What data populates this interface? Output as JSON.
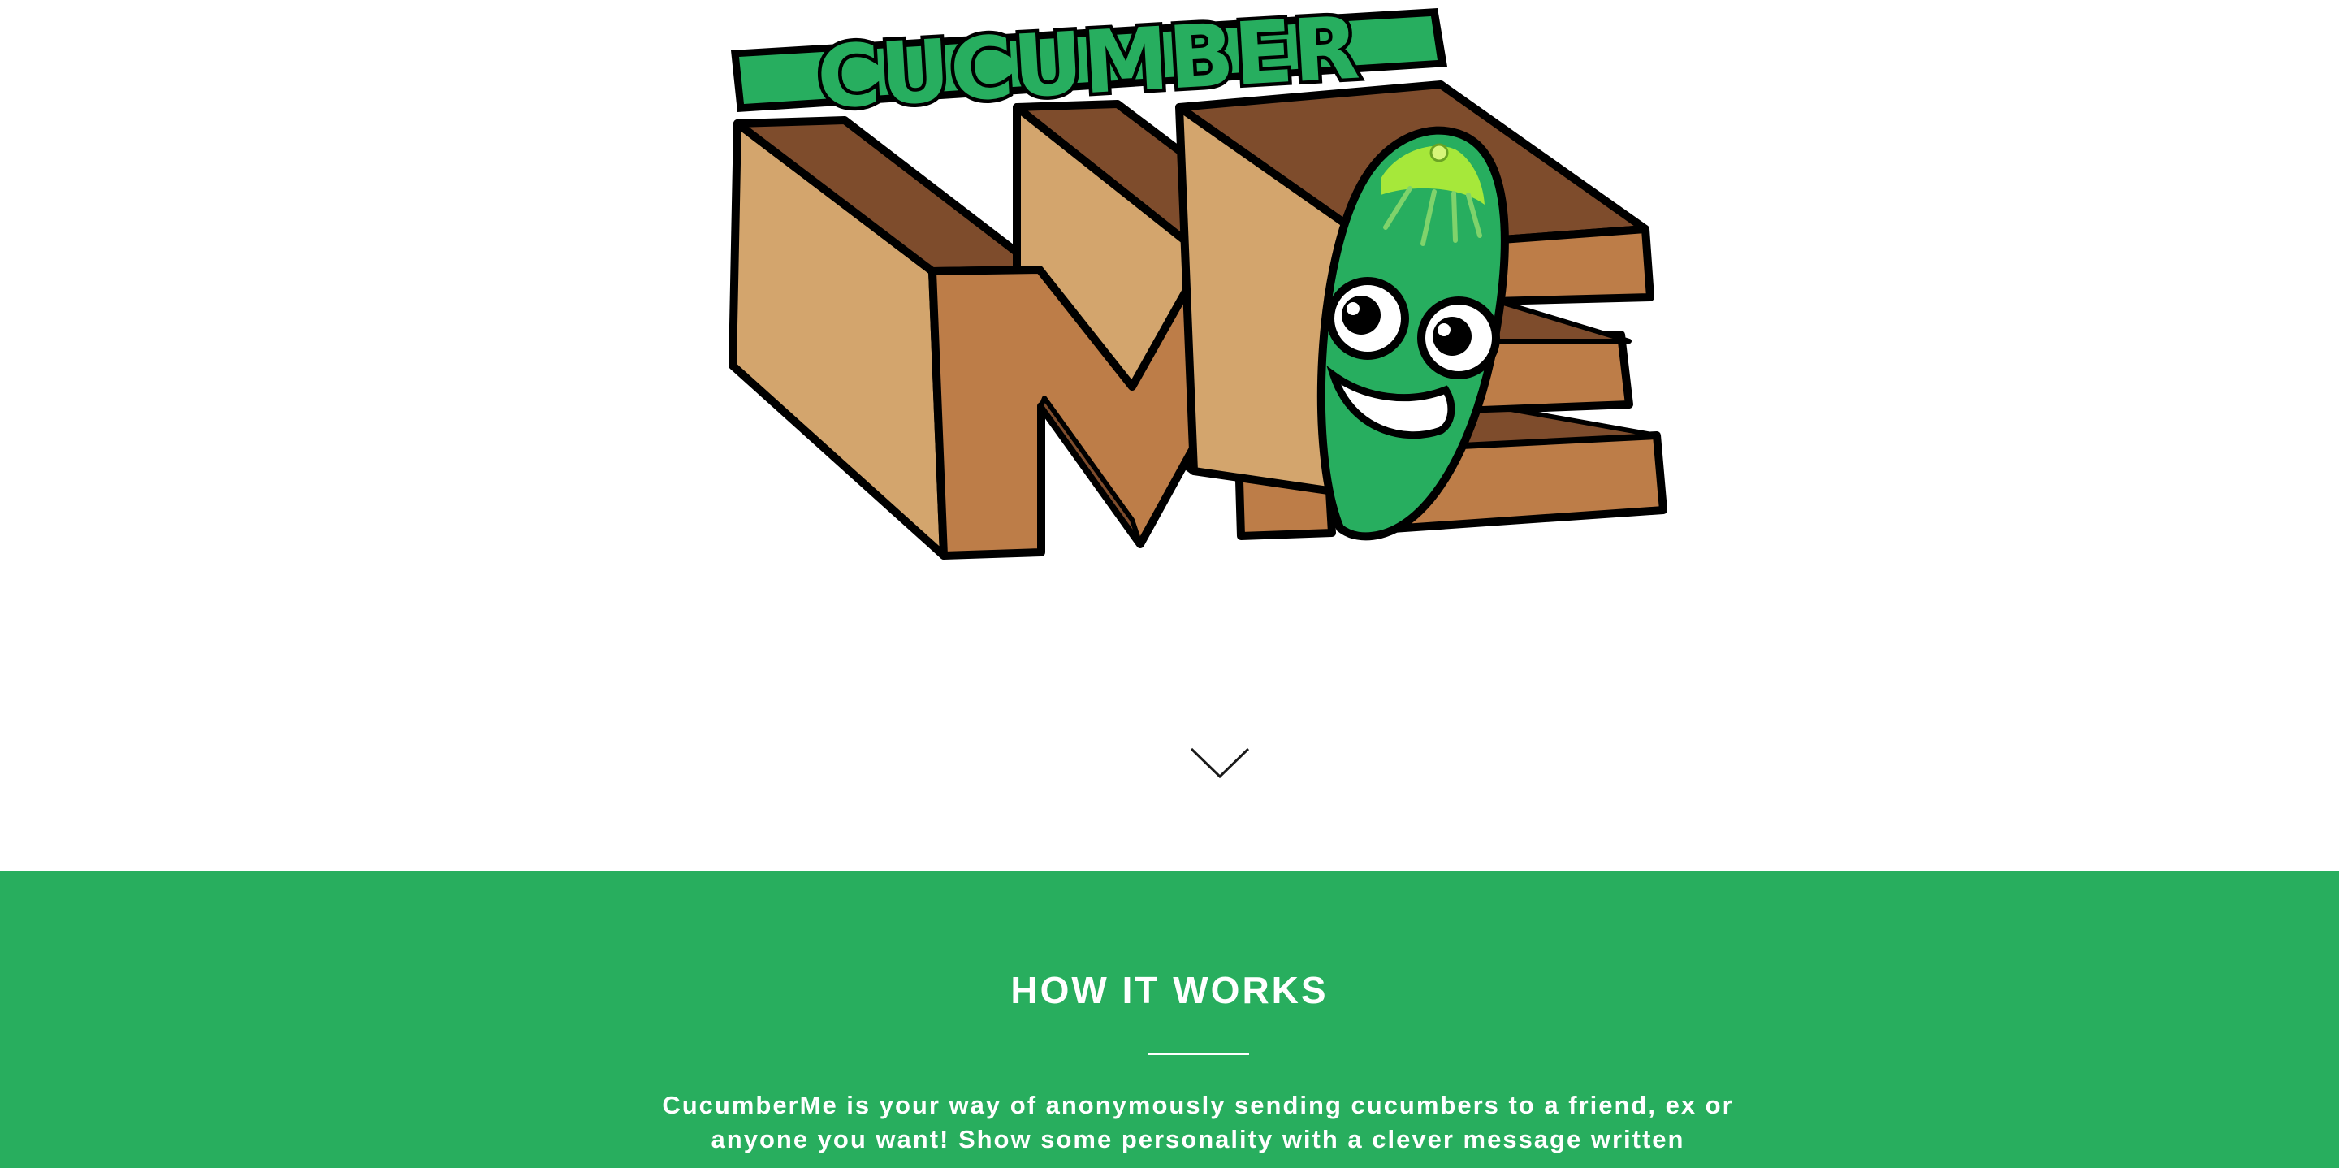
{
  "logo": {
    "wordmark_top": "CUCUMBER",
    "wordmark_bottom": "ME",
    "colors": {
      "green": "#27ae5f",
      "green_dark": "#1e8f4c",
      "tip": "#a6e83a",
      "wood_top": "#7e4c2c",
      "wood_side": "#d3a56d",
      "wood_front": "#bd7d48",
      "outline": "#000000"
    }
  },
  "scroll": {
    "icon": "chevron-down-icon"
  },
  "how_it_works": {
    "title": "HOW IT WORKS",
    "text": "CucumberMe is your way of anonymously sending cucumbers to a friend, ex or anyone you want! Show some personality with a clever message written",
    "background": "#28ae5e"
  }
}
